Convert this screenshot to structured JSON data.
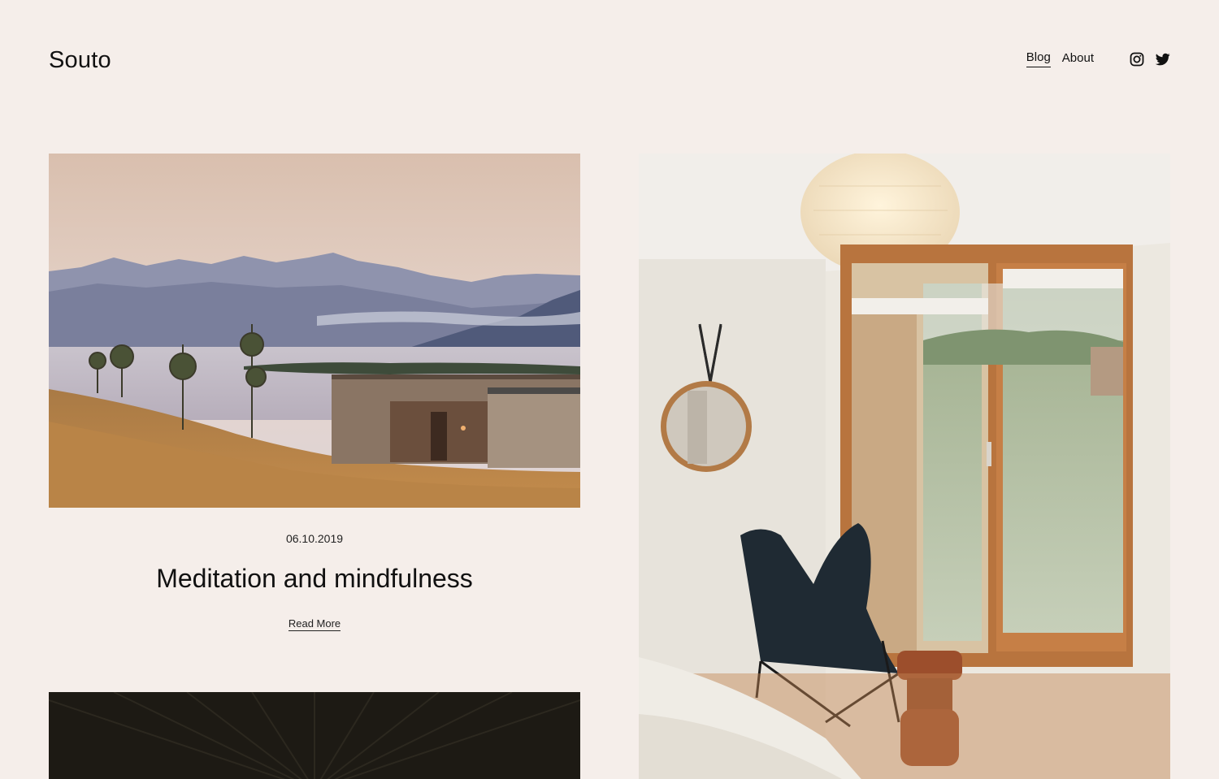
{
  "site": {
    "logo": "Souto"
  },
  "nav": {
    "items": [
      {
        "label": "Blog",
        "active": true
      },
      {
        "label": "About",
        "active": false
      }
    ],
    "social": [
      "instagram-icon",
      "twitter-icon"
    ]
  },
  "posts": [
    {
      "date": "06.10.2019",
      "title": "Meditation and mindfulness",
      "read_more": "Read More",
      "image": "mountain-lake-cabin-photo"
    },
    {
      "image": "bedroom-interior-photo"
    },
    {
      "image": "dark-wood-ceiling-photo"
    }
  ],
  "colors": {
    "background": "#f5eeea",
    "text": "#111111"
  }
}
